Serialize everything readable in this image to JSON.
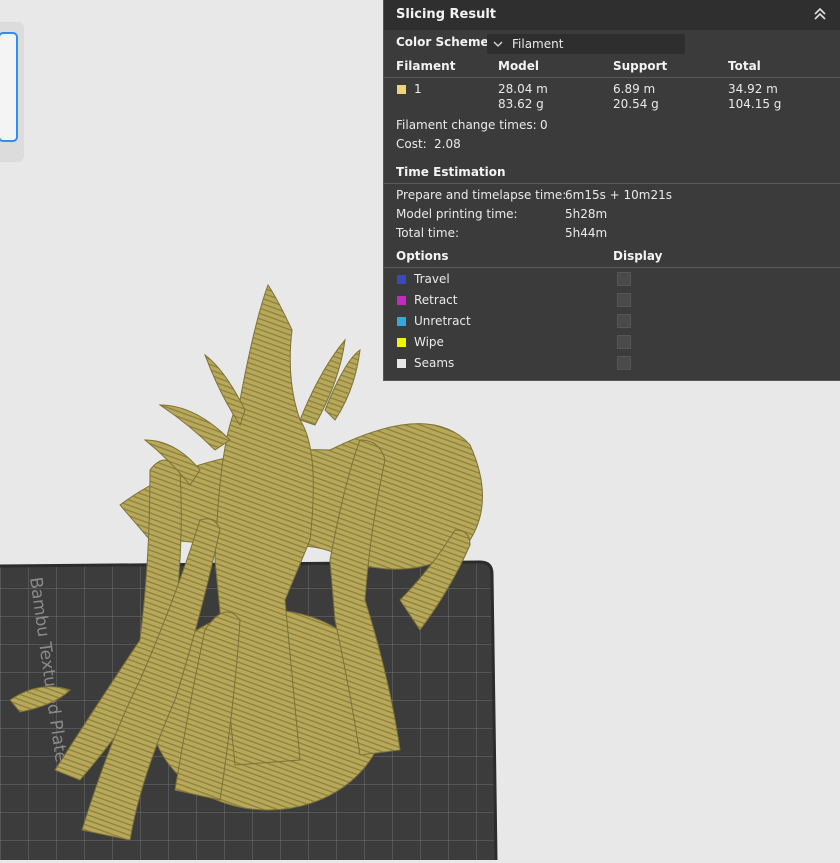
{
  "panel": {
    "title": "Slicing Result",
    "color_scheme": {
      "label": "Color Scheme",
      "value": "Filament"
    },
    "table": {
      "headers": [
        "Filament",
        "Model",
        "Support",
        "Total"
      ],
      "rows": [
        {
          "filament": "1",
          "swatch_color": "#f0d27a",
          "model": [
            "28.04 m",
            "83.62 g"
          ],
          "support": [
            "6.89 m",
            "20.54 g"
          ],
          "total": [
            "34.92 m",
            "104.15 g"
          ]
        }
      ]
    },
    "filament_change": {
      "label": "Filament change times:",
      "value": "0"
    },
    "cost": {
      "label": "Cost:",
      "value": "2.08"
    },
    "time_estimation": {
      "title": "Time Estimation",
      "rows": [
        {
          "label": "Prepare and timelapse time:",
          "value": "6m15s + 10m21s"
        },
        {
          "label": "Model printing time:",
          "value": "5h28m"
        },
        {
          "label": "Total time:",
          "value": "5h44m"
        }
      ]
    },
    "options": {
      "header": "Options",
      "display_header": "Display",
      "items": [
        {
          "label": "Travel",
          "color": "#3a4ab8"
        },
        {
          "label": "Retract",
          "color": "#c429c4"
        },
        {
          "label": "Unretract",
          "color": "#35a9d8"
        },
        {
          "label": "Wipe",
          "color": "#f2f20a"
        },
        {
          "label": "Seams",
          "color": "#e8e8e8"
        }
      ]
    }
  },
  "viewport": {
    "plate_label": "Bambu Textured Plate",
    "model_color": "#b5a556",
    "plate_color": "#3c3c3c"
  }
}
